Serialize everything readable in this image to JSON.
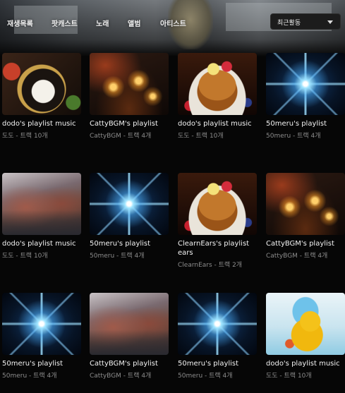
{
  "tabs": [
    "재생목록",
    "팟캐스트",
    "노래",
    "앨범",
    "아티스트"
  ],
  "sort": {
    "label": "최근활동"
  },
  "cards": [
    {
      "title": "dodo's playlist music",
      "subtitle": "도도 - 트랙 10개",
      "art": "food-bowl"
    },
    {
      "title": "CattyBGM's playlist",
      "subtitle": "CattyBGM - 트랙 4개",
      "art": "candles"
    },
    {
      "title": "dodo's playlist music",
      "subtitle": "도도 - 트랙 10개",
      "art": "pancakes"
    },
    {
      "title": "50meru's playlist",
      "subtitle": "50meru - 트랙 4개",
      "art": "blue-star"
    },
    {
      "title": "dodo's playlist music",
      "subtitle": "도도 - 트랙 10개",
      "art": "mountains"
    },
    {
      "title": "50meru's playlist",
      "subtitle": "50meru - 트랙 4개",
      "art": "blue-star"
    },
    {
      "title": "ClearnEars's playlist ears",
      "subtitle": "ClearnEars - 트랙 2개",
      "art": "pancakes"
    },
    {
      "title": "CattyBGM's playlist",
      "subtitle": "CattyBGM - 트랙 4개",
      "art": "candles"
    },
    {
      "title": "50meru's playlist",
      "subtitle": "50meru - 트랙 4개",
      "art": "blue-star"
    },
    {
      "title": "CattyBGM's playlist",
      "subtitle": "CattyBGM - 트랙 4개",
      "art": "mountains"
    },
    {
      "title": "50meru's playlist",
      "subtitle": "50meru - 트랙 4개",
      "art": "blue-star"
    },
    {
      "title": "dodo's playlist music",
      "subtitle": "도도 - 트랙 10개",
      "art": "rubber-duck"
    }
  ]
}
